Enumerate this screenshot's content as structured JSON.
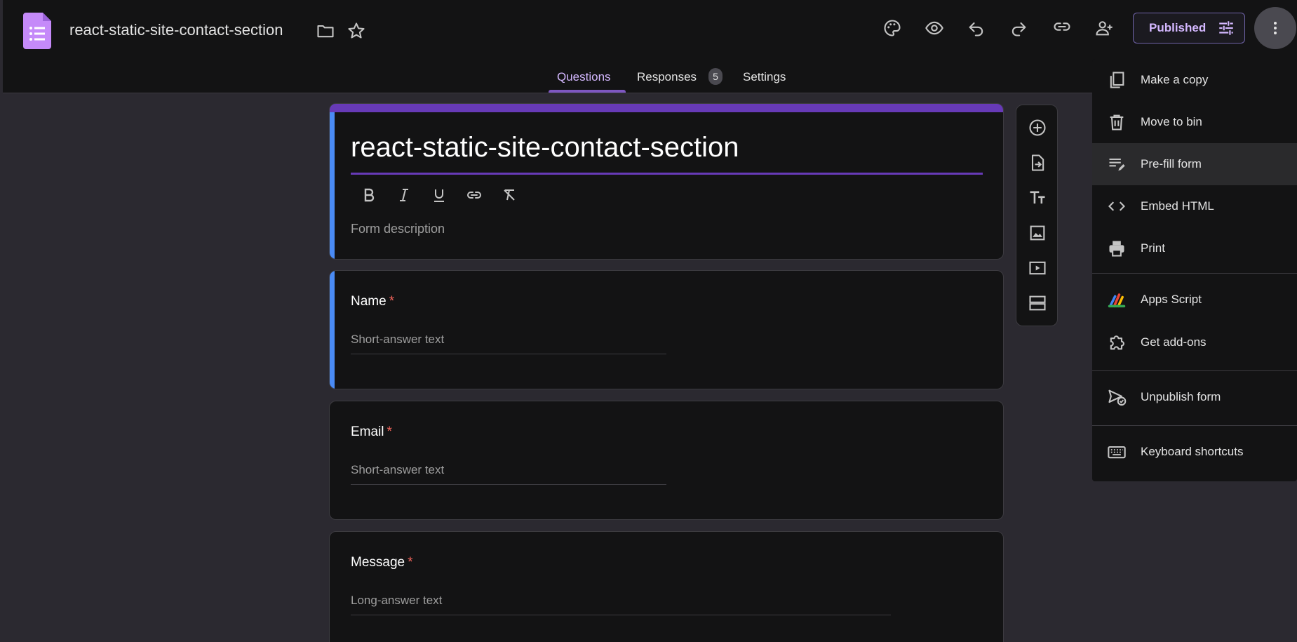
{
  "header": {
    "doc_title": "react-static-site-contact-section",
    "publish_label": "Published",
    "icons": [
      "forms-logo-icon",
      "folder-icon",
      "star-icon",
      "palette-icon",
      "preview-icon",
      "undo-icon",
      "redo-icon",
      "link-icon",
      "add-collaborator-icon",
      "publish-settings-icon",
      "more-vert-icon"
    ]
  },
  "tabs": {
    "questions": "Questions",
    "responses": "Responses",
    "responses_count": "5",
    "settings": "Settings"
  },
  "form": {
    "title": "react-static-site-contact-section",
    "description_placeholder": "Form description",
    "format_icons": [
      "bold-icon",
      "italic-icon",
      "underline-icon",
      "link-icon",
      "clear-format-icon"
    ],
    "questions": [
      {
        "title": "Name",
        "required": "*",
        "placeholder": "Short-answer text"
      },
      {
        "title": "Email",
        "required": "*",
        "placeholder": "Short-answer text"
      },
      {
        "title": "Message",
        "required": "*",
        "placeholder": "Long-answer text"
      }
    ]
  },
  "toolbar": {
    "icons": [
      "add-question-icon",
      "import-questions-icon",
      "add-title-icon",
      "add-image-icon",
      "add-video-icon",
      "add-section-icon"
    ]
  },
  "menu": {
    "items": [
      {
        "label": "Make a copy",
        "icon": "copy-icon"
      },
      {
        "label": "Move to bin",
        "icon": "trash-icon"
      },
      {
        "label": "Pre-fill form",
        "icon": "prefill-icon"
      },
      {
        "label": "Embed HTML",
        "icon": "code-icon"
      },
      {
        "label": "Print",
        "icon": "print-icon"
      },
      {
        "label": "Apps Script",
        "icon": "apps-script-icon"
      },
      {
        "label": "Get add-ons",
        "icon": "puzzle-icon"
      },
      {
        "label": "Unpublish form",
        "icon": "unpublish-icon"
      },
      {
        "label": "Keyboard shortcuts",
        "icon": "keyboard-icon"
      }
    ]
  },
  "colors": {
    "accent": "#673ab7",
    "active_tab": "#d4b8ff",
    "focus_bar": "#4a8bf5",
    "required": "#f2645b",
    "background": "#2b2930",
    "surface": "#131314"
  }
}
